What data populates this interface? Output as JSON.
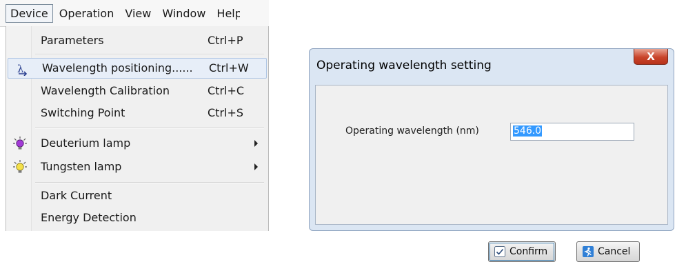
{
  "menubar": {
    "items": [
      "Device",
      "Operation",
      "View",
      "Window",
      "Help"
    ]
  },
  "device_menu": {
    "items": [
      {
        "label": "Parameters",
        "shortcut": "Ctrl+P"
      },
      {
        "label": "Wavelength positioning......",
        "shortcut": "Ctrl+W",
        "icon": "lambda-arrow-icon"
      },
      {
        "label": "Wavelength Calibration",
        "shortcut": "Ctrl+C"
      },
      {
        "label": "Switching Point",
        "shortcut": "Ctrl+S"
      },
      {
        "label": "Deuterium lamp",
        "icon": "bulb-purple-icon",
        "submenu": true
      },
      {
        "label": "Tungsten lamp",
        "icon": "bulb-yellow-icon",
        "submenu": true
      },
      {
        "label": "Dark Current"
      },
      {
        "label": "Energy Detection"
      }
    ]
  },
  "dialog": {
    "title": "Operating wavelength setting",
    "close_label": "X",
    "field_label": "Operating wavelength (nm)",
    "field_value": "546.0",
    "confirm_label": "Confirm",
    "cancel_label": "Cancel"
  },
  "colors": {
    "highlight": "#e7eef8",
    "dialog_frame": "#dbe6f3",
    "close_button": "#c9442a",
    "selection": "#3399ff"
  }
}
